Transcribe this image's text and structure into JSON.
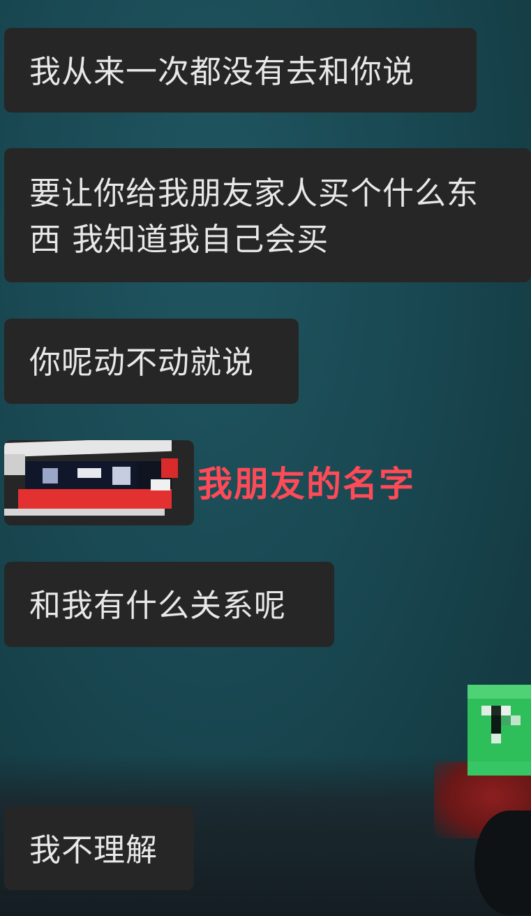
{
  "messages": [
    {
      "id": "b1",
      "text": "我从来一次都没有去和你说"
    },
    {
      "id": "b2",
      "lines": [
        "要让你给我朋友家人买个什么东",
        "西 我知道我自己会买"
      ]
    },
    {
      "id": "b3",
      "text": "你呢动不动就说"
    },
    {
      "id": "b4",
      "text": ""
    },
    {
      "id": "b5",
      "text": "和我有什么关系呢"
    },
    {
      "id": "b6",
      "text": "我不理解"
    }
  ],
  "annotation": {
    "text": "我朋友的名字",
    "color": "#ff4a57"
  },
  "colors": {
    "bubble": "#262626",
    "bubble_text": "#e8e8e8",
    "avatar_green": "#2fbf5a"
  }
}
